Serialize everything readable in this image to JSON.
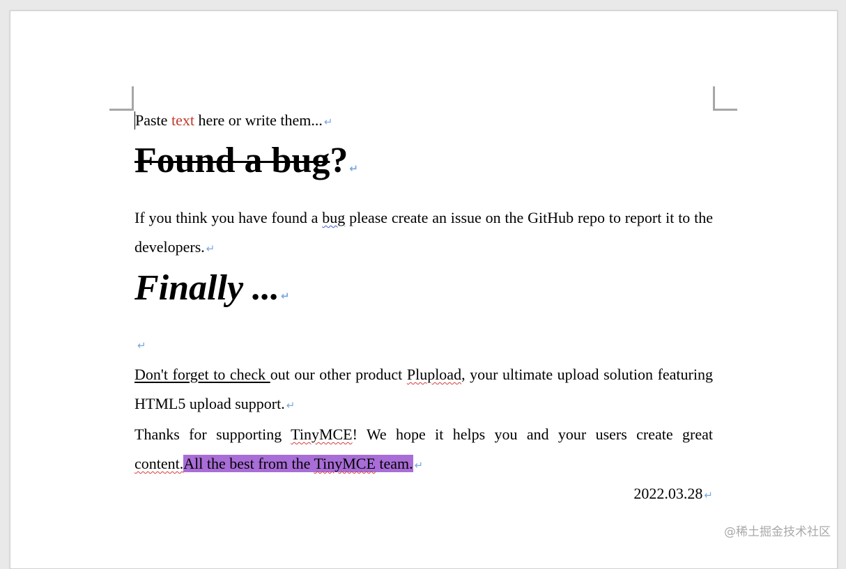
{
  "document": {
    "line1": {
      "before": "Paste ",
      "red": "text",
      "after": " here or write them..."
    },
    "heading1": {
      "struck": "Found a bug",
      "rest": "?"
    },
    "para_bug": {
      "before": "If you think you have found a ",
      "wavy": "bug",
      "after": " please create an issue on the GitHub repo to report it to the developers."
    },
    "heading2": "Finally ...",
    "para_plupload": {
      "underlined": "Don't forget to check ",
      "mid": "out our other product ",
      "wavy": "Plupload",
      "after": ", your ultimate upload solution featuring HTML5 upload support."
    },
    "para_thanks": {
      "before": "Thanks for supporting ",
      "wavy1": "TinyMCE",
      "mid": "! We hope it helps you and your users create great ",
      "wavy2": "content.",
      "hl_before": "All the best from the ",
      "hl_wavy": "TinyMCE",
      "hl_after": " team."
    },
    "date": "2022.03.28",
    "paragraph_mark": "↵"
  },
  "watermark": "@稀土掘金技术社区",
  "colors": {
    "red_text": "#c0392b",
    "highlight": "#a86dd6",
    "paragraph_mark": "#7aa7e0"
  }
}
